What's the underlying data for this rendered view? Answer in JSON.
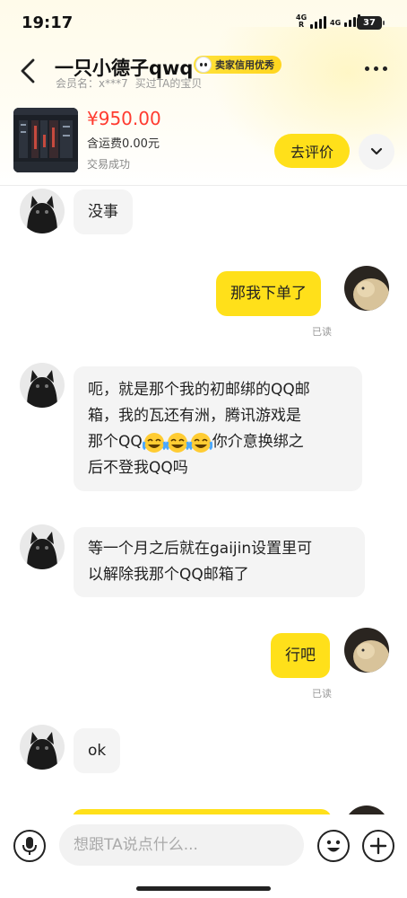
{
  "status_bar": {
    "time": "19:17",
    "network_1": "4G",
    "network_1_sub": "R",
    "network_2": "4G",
    "battery": "37"
  },
  "header": {
    "seller_name": "一只小德子qwq",
    "badge": "卖家信用优秀",
    "member_label": "会员名：x***7",
    "bought_label": "买过TA的宝贝"
  },
  "product": {
    "price": "¥950.00",
    "shipping": "含运费0.00元",
    "status": "交易成功",
    "review_button": "去评价"
  },
  "messages": [
    {
      "side": "left",
      "text": "没事"
    },
    {
      "side": "right",
      "text": "那我下单了",
      "read": "已读"
    },
    {
      "side": "left",
      "lines": [
        "呃，就是那个我的初邮绑的QQ邮",
        "箱，我的瓦还有洲，腾讯游戏是",
        "那个QQ",
        "你介意换绑之",
        "后不登我QQ吗"
      ],
      "emoji": "laughing-crying"
    },
    {
      "side": "left",
      "lines": [
        "等一个月之后就在gaijin设置里可",
        "以解除我那个QQ邮箱了"
      ]
    },
    {
      "side": "right",
      "text": "行吧",
      "read": "已读"
    },
    {
      "side": "left",
      "text": "ok"
    }
  ],
  "input_bar": {
    "placeholder": "想跟TA说点什么..."
  },
  "colors": {
    "accent": "#ffe01a",
    "price": "#ff3b30",
    "bubble_left": "#f4f4f4"
  }
}
